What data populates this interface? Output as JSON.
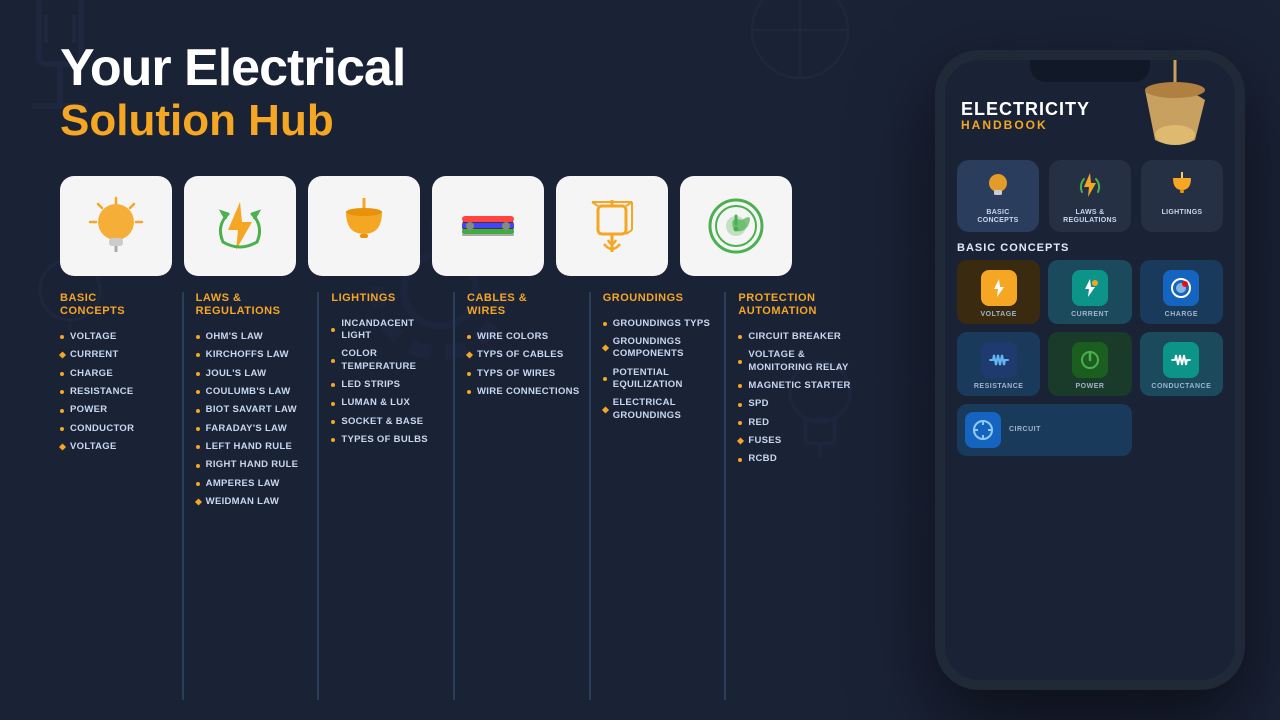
{
  "hero": {
    "line1": "Your Electrical",
    "line2": "Solution Hub"
  },
  "categories": [
    {
      "id": "basic-concepts",
      "title": "BASIC\nCONCEPTS",
      "items": [
        "VOLTAGE",
        "CURRENT",
        "CHARGE",
        "RESISTANCE",
        "POWER",
        "CONDUCTOR",
        "VOLTAGE"
      ],
      "icon": "💡"
    },
    {
      "id": "laws-regulations",
      "title": "LAWS &\nREGULATIONS",
      "items": [
        "OHM'S LAW",
        "KIRCHOFFS LAW",
        "JOUL'S LAW",
        "COULUMB'S LAW",
        "BIOT SAVART LAW",
        "FARADAY'S LAW",
        "LEFT HAND RULE",
        "RIGHT HAND RULE",
        "AMPERES LAW",
        "WEIDMAN LAW"
      ],
      "icon": "⚡"
    },
    {
      "id": "lightings",
      "title": "LIGHTINGS",
      "items": [
        "INCANDACENT LIGHT",
        "COLOR TEMPERATURE",
        "LED STRIPS",
        "LUMAN & LUX",
        "SOCKET & BASE",
        "TYPES OF BULBS"
      ],
      "icon": "🔦"
    },
    {
      "id": "cables-wires",
      "title": "CABLES &\nWIRES",
      "items": [
        "WIRE COLORS",
        "TYPS OF CABLES",
        "TYPS OF WIRES",
        "WIRE CONNECTIONS"
      ],
      "icon": "🔌"
    },
    {
      "id": "groundings",
      "title": "GROUNDINGS",
      "items": [
        "GROUNDINGS TYPS",
        "GROUNDINGS COMPONENTS",
        "POTENTIAL EQUILIZATION",
        "ELECTRICAL GROUNDINGS"
      ],
      "icon": "⏚"
    },
    {
      "id": "protection-automation",
      "title": "PROTECTION\nAUTOMATION",
      "items": [
        "CIRCUIT BREAKER",
        "VOLTAGE & MONITORING RELAY",
        "MAGNETIC STARTER",
        "SPD",
        "RED",
        "FUSES",
        "RCBD"
      ],
      "icon": "🛡"
    }
  ],
  "phone": {
    "app_title": "ELECTRICITY",
    "app_subtitle": "HANDBOOK",
    "top_icons": [
      {
        "label": "BASIC\nCONCEPTS",
        "emoji": "💡"
      },
      {
        "label": "LAWS &\nREGULATIONS",
        "emoji": "⚡"
      },
      {
        "label": "LIGHTINGS",
        "emoji": "💛"
      }
    ],
    "section_title": "BASIC CONCEPTS",
    "grid_items": [
      {
        "label": "VOLTAGE",
        "emoji": "⚡",
        "color": "yellow"
      },
      {
        "label": "CURRENT",
        "emoji": "🔋",
        "color": "teal"
      },
      {
        "label": "CHARGE",
        "emoji": "🌐",
        "color": "blue"
      },
      {
        "label": "RESISTANCE",
        "emoji": "〰",
        "color": "blue"
      },
      {
        "label": "POWER",
        "emoji": "⚙",
        "color": "green"
      },
      {
        "label": "CONDUCTANCE",
        "emoji": "〰",
        "color": "teal"
      },
      {
        "label": "CIRCUIT",
        "emoji": "🔵",
        "color": "blue"
      }
    ]
  }
}
